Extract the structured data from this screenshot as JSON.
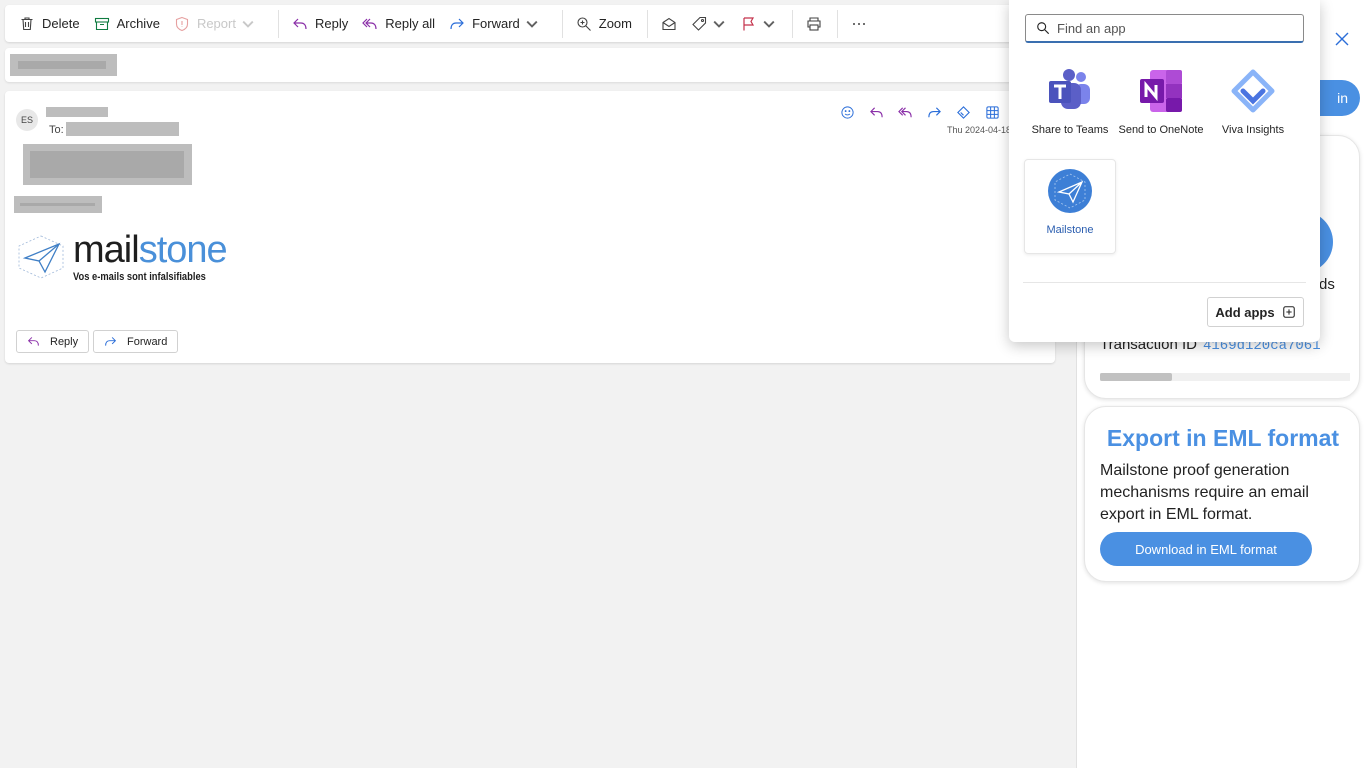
{
  "toolbar": {
    "delete": "Delete",
    "archive": "Archive",
    "report": "Report",
    "reply": "Reply",
    "reply_all": "Reply all",
    "forward": "Forward",
    "zoom": "Zoom"
  },
  "message": {
    "avatar_initials": "ES",
    "to_label": "To:",
    "date": "Thu 2024-04-18",
    "logo_part1": "mail",
    "logo_part2": "stone",
    "logo_tagline": "Vos e-mails sont infalsifiables",
    "reply_button": "Reply",
    "forward_button": "Forward"
  },
  "app_flyout": {
    "search_placeholder": "Find an app",
    "apps": [
      {
        "name": "Share to Teams",
        "icon": "teams-icon"
      },
      {
        "name": "Send to OneNote",
        "icon": "onenote-icon"
      },
      {
        "name": "Viva Insights",
        "icon": "viva-insights-icon"
      },
      {
        "name": "Mailstone",
        "icon": "mailstone-icon"
      }
    ],
    "add_apps": "Add apps"
  },
  "right_pane": {
    "signin_fragment": "in",
    "records_fragment": "rds",
    "transaction_label": "Transaction ID",
    "transaction_id": "4169d120ca7061",
    "export_title": "Export in EML format",
    "export_text": "Mailstone proof generation mechanisms require an email export in EML format.",
    "download_button": "Download in EML format"
  },
  "colors": {
    "accent": "#4a90e2",
    "teams": "#5b5fc7",
    "onenote": "#7719aa"
  }
}
